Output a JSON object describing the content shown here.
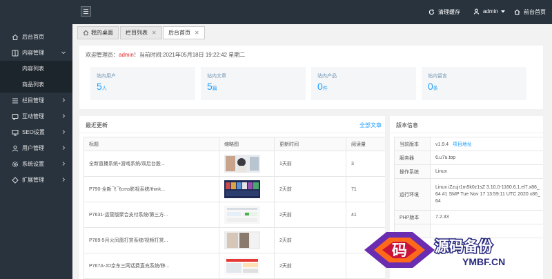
{
  "sidebar": {
    "items": [
      {
        "label": "后台首页",
        "icon": "home-icon"
      },
      {
        "label": "内容管理",
        "icon": "grid-icon",
        "expanded": true,
        "children": [
          "内容列表",
          "商品列表"
        ]
      },
      {
        "label": "栏目管理",
        "icon": "list-icon"
      },
      {
        "label": "互动管理",
        "icon": "chat-icon"
      },
      {
        "label": "SEO设置",
        "icon": "seo-icon"
      },
      {
        "label": "用户管理",
        "icon": "user-icon"
      },
      {
        "label": "系统设置",
        "icon": "gear-icon"
      },
      {
        "label": "扩展管理",
        "icon": "ext-icon"
      }
    ]
  },
  "header": {
    "clear_cache": "清理缓存",
    "user": "admin",
    "frontend": "前台首页"
  },
  "tabs": [
    "我的桌面",
    "栏目列表",
    "后台首页"
  ],
  "welcome": {
    "prefix": "欢迎管理员：",
    "user": "admin",
    "suffix": "！当前时间:2021年05月18日 19:22:42 星期二"
  },
  "stats": [
    {
      "label": "站内用户",
      "value": "5",
      "unit": "人"
    },
    {
      "label": "站内文章",
      "value": "5",
      "unit": "篇"
    },
    {
      "label": "站内产品",
      "value": "0",
      "unit": "件"
    },
    {
      "label": "站内留言",
      "value": "0",
      "unit": "条"
    }
  ],
  "updates": {
    "title": "最近更新",
    "link": "全部文章",
    "columns": [
      "标题",
      "缩略图",
      "更新时间",
      "阅读量"
    ],
    "rows": [
      {
        "title": "全新直播系统+游戏系统/双后台股...",
        "time": "1天前",
        "views": "3"
      },
      {
        "title": "P790-全新飞飞cms影视系统/think...",
        "time": "2天前",
        "views": "71"
      },
      {
        "title": "P7631-运营版聚合支付系统/第三方...",
        "time": "2天前",
        "views": "41"
      },
      {
        "title": "P789-5月火凤凰打赏系统/视频打赏...",
        "time": "2天前",
        "views": ""
      },
      {
        "title": "P767A-JD京东三网话费直充系统/移...",
        "time": "2天前",
        "views": ""
      }
    ]
  },
  "version": {
    "title": "版本信息",
    "rows": [
      {
        "key": "当前版本",
        "value": "v1.9.4",
        "link": "项目地址"
      },
      {
        "key": "服务器",
        "value": "6.u7u.top"
      },
      {
        "key": "操作系统",
        "value": "Linux"
      },
      {
        "key": "运行环境",
        "value": "Linux iZzujr1m5k0z1sZ 3.10.0-1160.6.1.el7.x86_64 #1 SMP Tue Nov 17 13:59:11 UTC 2020 x86_64"
      },
      {
        "key": "PHP版本",
        "value": "7.2.33"
      }
    ]
  },
  "watermark": {
    "cn": "源码备份",
    "en": "YMBF.CN",
    "glyph": "码"
  },
  "colors": {
    "sidebar": "#28333e",
    "accent": "#1e9fff",
    "admin": "#e0272c"
  }
}
